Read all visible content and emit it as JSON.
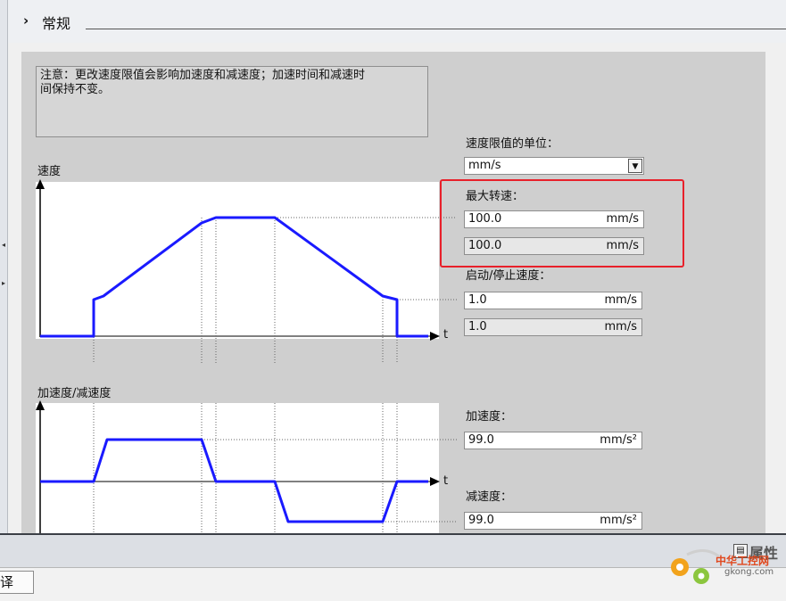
{
  "section": {
    "chevron": "›",
    "title": "常规"
  },
  "note": "注意：更改速度限值会影响加速度和减速度；加速时间和减速时\n间保持不变。",
  "speed_chart": {
    "title": "速度",
    "axis_label": "t"
  },
  "accel_chart": {
    "title": "加速度/减速度",
    "axis_label": "t"
  },
  "unit_select": {
    "label": "速度限值的单位：",
    "value": "mm/s"
  },
  "max_speed": {
    "label": "最大转速：",
    "input": "100.0",
    "input_unit": "mm/s",
    "readout": "100.0",
    "readout_unit": "mm/s"
  },
  "start_stop_speed": {
    "label": "启动/停止速度：",
    "input": "1.0",
    "input_unit": "mm/s",
    "readout": "1.0",
    "readout_unit": "mm/s"
  },
  "acceleration": {
    "label": "加速度：",
    "input": "99.0",
    "unit": "mm/s²"
  },
  "deceleration": {
    "label": "减速度：",
    "input": "99.0",
    "unit": "mm/s²"
  },
  "properties_button": "属性",
  "bottom_tab": "译",
  "watermark": {
    "cn": "中华工控网",
    "url": "gkong.com"
  },
  "colors": {
    "curve": "#1a1aff",
    "highlight": "#e8202a",
    "panel": "#cfcfcf"
  }
}
